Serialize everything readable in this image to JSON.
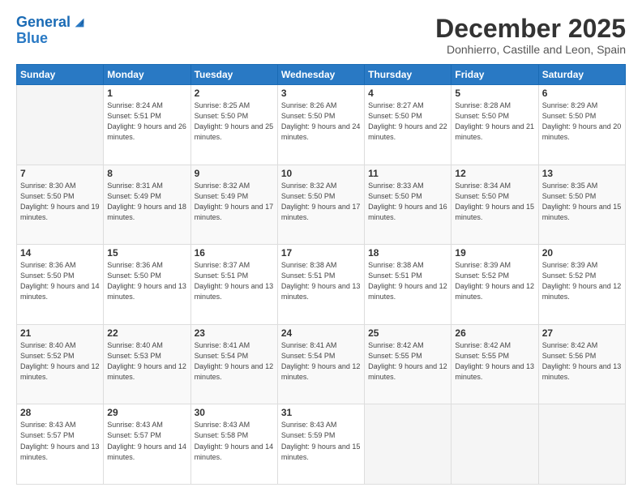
{
  "logo": {
    "line1": "General",
    "line2": "Blue"
  },
  "title": "December 2025",
  "location": "Donhierro, Castille and Leon, Spain",
  "days_header": [
    "Sunday",
    "Monday",
    "Tuesday",
    "Wednesday",
    "Thursday",
    "Friday",
    "Saturday"
  ],
  "weeks": [
    [
      {
        "day": "",
        "sunrise": "",
        "sunset": "",
        "daylight": ""
      },
      {
        "day": "1",
        "sunrise": "Sunrise: 8:24 AM",
        "sunset": "Sunset: 5:51 PM",
        "daylight": "Daylight: 9 hours and 26 minutes."
      },
      {
        "day": "2",
        "sunrise": "Sunrise: 8:25 AM",
        "sunset": "Sunset: 5:50 PM",
        "daylight": "Daylight: 9 hours and 25 minutes."
      },
      {
        "day": "3",
        "sunrise": "Sunrise: 8:26 AM",
        "sunset": "Sunset: 5:50 PM",
        "daylight": "Daylight: 9 hours and 24 minutes."
      },
      {
        "day": "4",
        "sunrise": "Sunrise: 8:27 AM",
        "sunset": "Sunset: 5:50 PM",
        "daylight": "Daylight: 9 hours and 22 minutes."
      },
      {
        "day": "5",
        "sunrise": "Sunrise: 8:28 AM",
        "sunset": "Sunset: 5:50 PM",
        "daylight": "Daylight: 9 hours and 21 minutes."
      },
      {
        "day": "6",
        "sunrise": "Sunrise: 8:29 AM",
        "sunset": "Sunset: 5:50 PM",
        "daylight": "Daylight: 9 hours and 20 minutes."
      }
    ],
    [
      {
        "day": "7",
        "sunrise": "Sunrise: 8:30 AM",
        "sunset": "Sunset: 5:50 PM",
        "daylight": "Daylight: 9 hours and 19 minutes."
      },
      {
        "day": "8",
        "sunrise": "Sunrise: 8:31 AM",
        "sunset": "Sunset: 5:49 PM",
        "daylight": "Daylight: 9 hours and 18 minutes."
      },
      {
        "day": "9",
        "sunrise": "Sunrise: 8:32 AM",
        "sunset": "Sunset: 5:49 PM",
        "daylight": "Daylight: 9 hours and 17 minutes."
      },
      {
        "day": "10",
        "sunrise": "Sunrise: 8:32 AM",
        "sunset": "Sunset: 5:50 PM",
        "daylight": "Daylight: 9 hours and 17 minutes."
      },
      {
        "day": "11",
        "sunrise": "Sunrise: 8:33 AM",
        "sunset": "Sunset: 5:50 PM",
        "daylight": "Daylight: 9 hours and 16 minutes."
      },
      {
        "day": "12",
        "sunrise": "Sunrise: 8:34 AM",
        "sunset": "Sunset: 5:50 PM",
        "daylight": "Daylight: 9 hours and 15 minutes."
      },
      {
        "day": "13",
        "sunrise": "Sunrise: 8:35 AM",
        "sunset": "Sunset: 5:50 PM",
        "daylight": "Daylight: 9 hours and 15 minutes."
      }
    ],
    [
      {
        "day": "14",
        "sunrise": "Sunrise: 8:36 AM",
        "sunset": "Sunset: 5:50 PM",
        "daylight": "Daylight: 9 hours and 14 minutes."
      },
      {
        "day": "15",
        "sunrise": "Sunrise: 8:36 AM",
        "sunset": "Sunset: 5:50 PM",
        "daylight": "Daylight: 9 hours and 13 minutes."
      },
      {
        "day": "16",
        "sunrise": "Sunrise: 8:37 AM",
        "sunset": "Sunset: 5:51 PM",
        "daylight": "Daylight: 9 hours and 13 minutes."
      },
      {
        "day": "17",
        "sunrise": "Sunrise: 8:38 AM",
        "sunset": "Sunset: 5:51 PM",
        "daylight": "Daylight: 9 hours and 13 minutes."
      },
      {
        "day": "18",
        "sunrise": "Sunrise: 8:38 AM",
        "sunset": "Sunset: 5:51 PM",
        "daylight": "Daylight: 9 hours and 12 minutes."
      },
      {
        "day": "19",
        "sunrise": "Sunrise: 8:39 AM",
        "sunset": "Sunset: 5:52 PM",
        "daylight": "Daylight: 9 hours and 12 minutes."
      },
      {
        "day": "20",
        "sunrise": "Sunrise: 8:39 AM",
        "sunset": "Sunset: 5:52 PM",
        "daylight": "Daylight: 9 hours and 12 minutes."
      }
    ],
    [
      {
        "day": "21",
        "sunrise": "Sunrise: 8:40 AM",
        "sunset": "Sunset: 5:52 PM",
        "daylight": "Daylight: 9 hours and 12 minutes."
      },
      {
        "day": "22",
        "sunrise": "Sunrise: 8:40 AM",
        "sunset": "Sunset: 5:53 PM",
        "daylight": "Daylight: 9 hours and 12 minutes."
      },
      {
        "day": "23",
        "sunrise": "Sunrise: 8:41 AM",
        "sunset": "Sunset: 5:54 PM",
        "daylight": "Daylight: 9 hours and 12 minutes."
      },
      {
        "day": "24",
        "sunrise": "Sunrise: 8:41 AM",
        "sunset": "Sunset: 5:54 PM",
        "daylight": "Daylight: 9 hours and 12 minutes."
      },
      {
        "day": "25",
        "sunrise": "Sunrise: 8:42 AM",
        "sunset": "Sunset: 5:55 PM",
        "daylight": "Daylight: 9 hours and 12 minutes."
      },
      {
        "day": "26",
        "sunrise": "Sunrise: 8:42 AM",
        "sunset": "Sunset: 5:55 PM",
        "daylight": "Daylight: 9 hours and 13 minutes."
      },
      {
        "day": "27",
        "sunrise": "Sunrise: 8:42 AM",
        "sunset": "Sunset: 5:56 PM",
        "daylight": "Daylight: 9 hours and 13 minutes."
      }
    ],
    [
      {
        "day": "28",
        "sunrise": "Sunrise: 8:43 AM",
        "sunset": "Sunset: 5:57 PM",
        "daylight": "Daylight: 9 hours and 13 minutes."
      },
      {
        "day": "29",
        "sunrise": "Sunrise: 8:43 AM",
        "sunset": "Sunset: 5:57 PM",
        "daylight": "Daylight: 9 hours and 14 minutes."
      },
      {
        "day": "30",
        "sunrise": "Sunrise: 8:43 AM",
        "sunset": "Sunset: 5:58 PM",
        "daylight": "Daylight: 9 hours and 14 minutes."
      },
      {
        "day": "31",
        "sunrise": "Sunrise: 8:43 AM",
        "sunset": "Sunset: 5:59 PM",
        "daylight": "Daylight: 9 hours and 15 minutes."
      },
      {
        "day": "",
        "sunrise": "",
        "sunset": "",
        "daylight": ""
      },
      {
        "day": "",
        "sunrise": "",
        "sunset": "",
        "daylight": ""
      },
      {
        "day": "",
        "sunrise": "",
        "sunset": "",
        "daylight": ""
      }
    ]
  ]
}
